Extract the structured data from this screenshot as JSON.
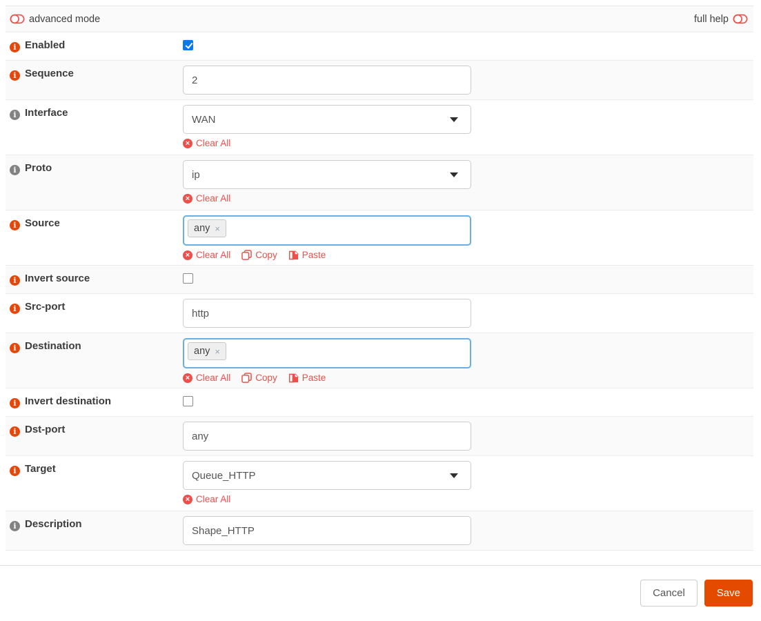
{
  "header": {
    "advanced_mode": "advanced mode",
    "full_help": "full help"
  },
  "actions": {
    "clear_all": "Clear All",
    "copy": "Copy",
    "paste": "Paste"
  },
  "icons": {
    "token_remove": "×",
    "clear_circle": "×",
    "info": "i"
  },
  "fields": {
    "enabled": {
      "label": "Enabled",
      "checked": true
    },
    "sequence": {
      "label": "Sequence",
      "value": "2"
    },
    "interface": {
      "label": "Interface",
      "value": "WAN"
    },
    "proto": {
      "label": "Proto",
      "value": "ip"
    },
    "source": {
      "label": "Source",
      "tokens": [
        "any"
      ]
    },
    "invert_source": {
      "label": "Invert source",
      "checked": false
    },
    "src_port": {
      "label": "Src-port",
      "value": "http"
    },
    "destination": {
      "label": "Destination",
      "tokens": [
        "any"
      ]
    },
    "invert_destination": {
      "label": "Invert destination",
      "checked": false
    },
    "dst_port": {
      "label": "Dst-port",
      "value": "any"
    },
    "target": {
      "label": "Target",
      "value": "Queue_HTTP"
    },
    "description": {
      "label": "Description",
      "value": "Shape_HTTP"
    }
  },
  "footer": {
    "cancel": "Cancel",
    "save": "Save"
  },
  "colors": {
    "accent": "#e44a00",
    "link_red": "#ee4f4b",
    "checkbox_blue": "#0b78f0",
    "token_focus_border": "#66afe9",
    "row_alt_bg": "#fafafa"
  }
}
